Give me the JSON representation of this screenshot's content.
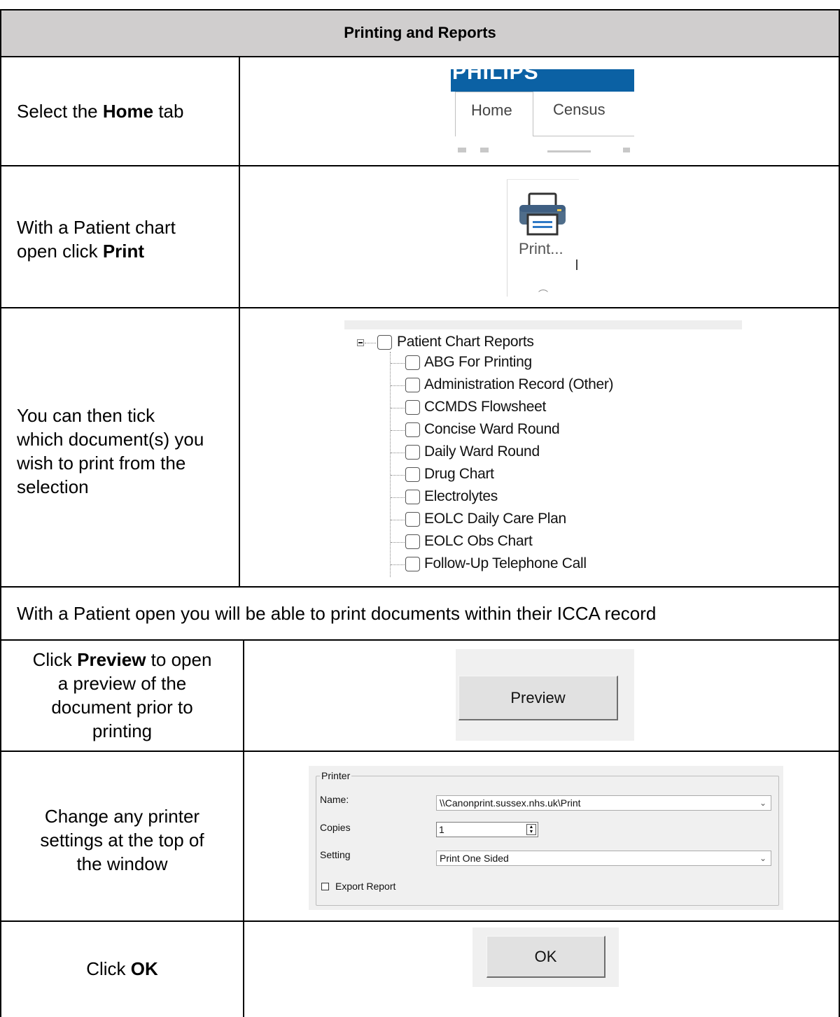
{
  "header": {
    "title": "Printing and Reports"
  },
  "steps": {
    "home_tab": {
      "pre": "Select the ",
      "bold": "Home",
      "post": " tab"
    },
    "print": {
      "line1": "With a Patient chart",
      "line2_pre": "open click ",
      "line2_bold": "Print"
    },
    "tick": {
      "line1": "You can then tick",
      "line2": "which document(s) you",
      "line3": "wish to print from the",
      "line4": "selection"
    },
    "info": "With a Patient open you will be able to print documents within their ICCA record",
    "preview": {
      "line1_pre": "Click ",
      "line1_bold": "Preview",
      "line1_post": " to open",
      "line2": "a preview of the",
      "line3": "document prior to",
      "line4": "printing"
    },
    "printer": {
      "line1": "Change any printer",
      "line2": "settings at the top of",
      "line3": "the window"
    },
    "ok": {
      "pre": "Click ",
      "bold": "OK"
    }
  },
  "tabs_screenshot": {
    "brand": "PHILIPS",
    "tab_home": "Home",
    "tab_census": "Census"
  },
  "print_screenshot": {
    "label": "Print...",
    "icon": "printer-icon"
  },
  "tree": {
    "root": "Patient Chart Reports",
    "items": [
      "ABG For Printing",
      "Administration Record (Other)",
      "CCMDS Flowsheet",
      "Concise Ward Round",
      "Daily Ward Round",
      "Drug Chart",
      "Electrolytes",
      "EOLC Daily Care Plan",
      "EOLC Obs Chart",
      "Follow-Up Telephone Call"
    ]
  },
  "preview_screenshot": {
    "button": "Preview"
  },
  "printer_screenshot": {
    "group": "Printer",
    "name_label": "Name:",
    "name_value": "\\\\Canonprint.sussex.nhs.uk\\Print",
    "copies_label": "Copies",
    "copies_value": "1",
    "setting_label": "Setting",
    "setting_value": "Print One Sided",
    "export_label": "Export Report",
    "export_checked": false
  },
  "ok_screenshot": {
    "button": "OK"
  }
}
